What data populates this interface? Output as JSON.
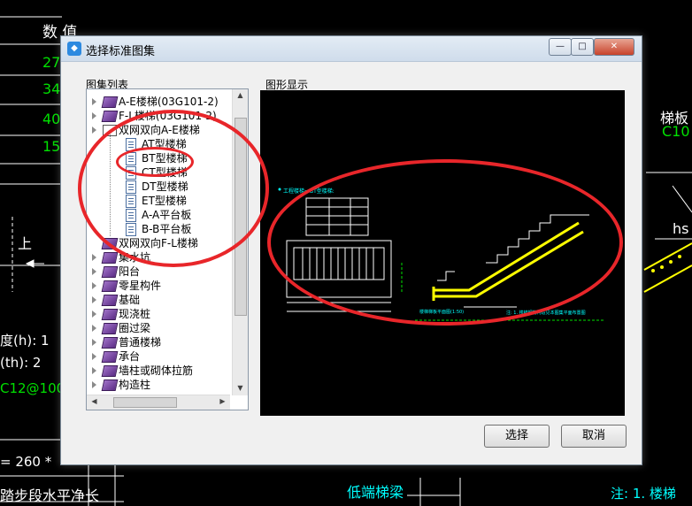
{
  "background": {
    "header_label": "数  值",
    "values": [
      "27",
      "34",
      "40",
      "15"
    ],
    "left_labels": [
      "度(h): 1",
      "(th): 2",
      "C12@100",
      "= 260 *",
      "踏步段水平净长"
    ],
    "side_char": "上",
    "right_labels": [
      "梯板",
      "C10",
      "hs"
    ],
    "bottom_label": "低端梯梁",
    "bottom_note": "注: 1. 楼梯"
  },
  "dialog": {
    "title": "选择标准图集",
    "list_group_label": "图集列表",
    "preview_group_label": "图形显示",
    "tree_items": [
      {
        "label": "A-E楼梯(03G101-2)",
        "icon": "purple-book-icon",
        "level": 0,
        "expandable": true
      },
      {
        "label": "F-L楼梯(03G101-2)",
        "icon": "purple-book-icon",
        "level": 0,
        "expandable": true
      },
      {
        "label": "双网双向A-E楼梯",
        "icon": "open-book-icon",
        "level": 0,
        "expandable": true
      },
      {
        "label": "AT型楼梯",
        "icon": "document-icon",
        "level": 1,
        "expandable": false
      },
      {
        "label": "BT型楼梯",
        "icon": "document-icon",
        "level": 1,
        "expandable": false
      },
      {
        "label": "CT型楼梯",
        "icon": "document-icon",
        "level": 1,
        "expandable": false
      },
      {
        "label": "DT型楼梯",
        "icon": "document-icon",
        "level": 1,
        "expandable": false
      },
      {
        "label": "ET型楼梯",
        "icon": "document-icon",
        "level": 1,
        "expandable": false
      },
      {
        "label": "A-A平台板",
        "icon": "document-icon",
        "level": 1,
        "expandable": false
      },
      {
        "label": "B-B平台板",
        "icon": "document-icon",
        "level": 1,
        "expandable": false
      },
      {
        "label": "双网双向F-L楼梯",
        "icon": "purple-book-icon",
        "level": 0,
        "expandable": false
      },
      {
        "label": "集水坑",
        "icon": "purple-book-icon",
        "level": 0,
        "expandable": true
      },
      {
        "label": "阳台",
        "icon": "purple-book-icon",
        "level": 0,
        "expandable": true
      },
      {
        "label": "零星构件",
        "icon": "purple-book-icon",
        "level": 0,
        "expandable": true
      },
      {
        "label": "基础",
        "icon": "purple-book-icon",
        "level": 0,
        "expandable": true
      },
      {
        "label": "现浇桩",
        "icon": "purple-book-icon",
        "level": 0,
        "expandable": true
      },
      {
        "label": "圈过梁",
        "icon": "purple-book-icon",
        "level": 0,
        "expandable": true
      },
      {
        "label": "普通楼梯",
        "icon": "purple-book-icon",
        "level": 0,
        "expandable": true
      },
      {
        "label": "承台",
        "icon": "purple-book-icon",
        "level": 0,
        "expandable": true
      },
      {
        "label": "墙柱或砌体拉筋",
        "icon": "purple-book-icon",
        "level": 0,
        "expandable": true
      },
      {
        "label": "构造柱",
        "icon": "purple-book-icon",
        "level": 0,
        "expandable": true
      }
    ],
    "selected_item": "BT型楼梯",
    "buttons": {
      "select": "选择",
      "cancel": "取消"
    },
    "window_controls": {
      "minimize": "—",
      "maximize": "□",
      "close": "✕"
    }
  },
  "preview_drawing": {
    "title": "工程楼梯一BT型楼梯:",
    "note": "注: 1. 楼梯钢筋构造见本图集平面布置图",
    "bottom_caption": "楼梯梯板平面图(1:50)"
  },
  "colors": {
    "cad_white": "#ffffff",
    "cad_green": "#00e000",
    "cad_cyan": "#00ffff",
    "cad_yellow": "#ffff00",
    "annotation_red": "#e8262a"
  }
}
